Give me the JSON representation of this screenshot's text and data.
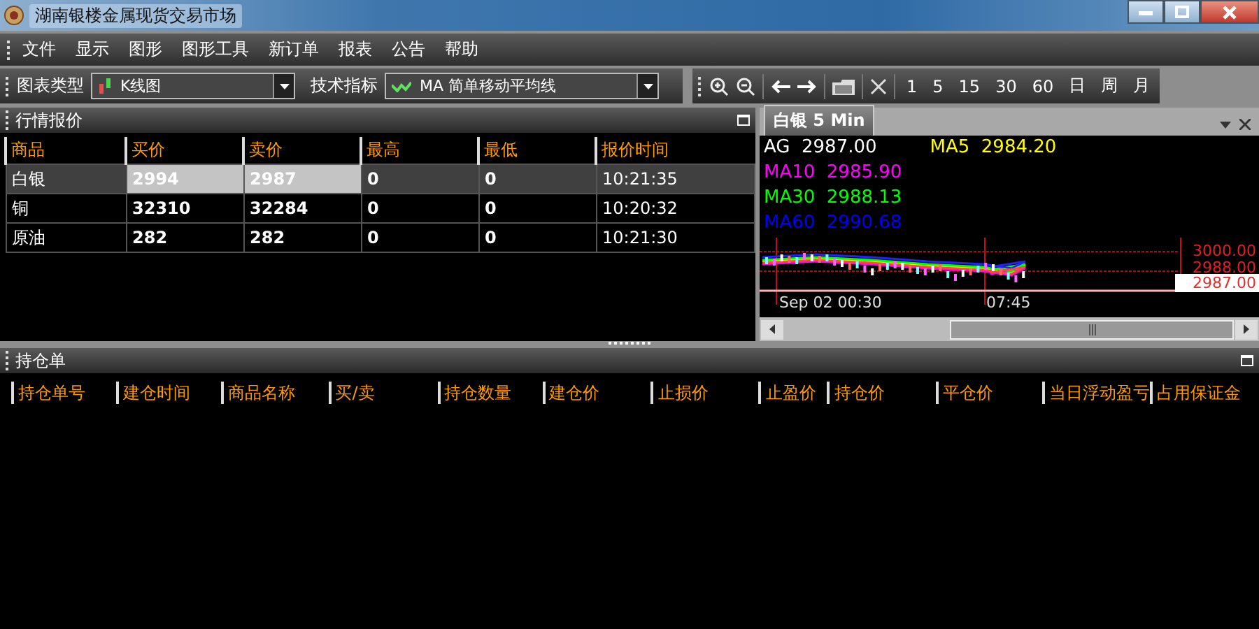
{
  "window": {
    "title": "湖南银楼金属现货交易市场"
  },
  "menu": [
    "文件",
    "显示",
    "图形",
    "图形工具",
    "新订单",
    "报表",
    "公告",
    "帮助"
  ],
  "toolbar": {
    "chart_type_label": "图表类型",
    "chart_type": "K线图",
    "indicator_label": "技术指标",
    "indicator": "MA 简单移动平均线",
    "periods": [
      "1",
      "5",
      "15",
      "30",
      "60",
      "日",
      "周",
      "月"
    ]
  },
  "quotes": {
    "title": "行情报价",
    "columns": [
      "商品",
      "买价",
      "卖价",
      "最高",
      "最低",
      "报价时间"
    ],
    "rows": [
      {
        "cells": [
          "白银",
          "2994",
          "2987",
          "0",
          "0",
          "10:21:35"
        ],
        "selected": true,
        "flash": true
      },
      {
        "cells": [
          "铜",
          "32310",
          "32284",
          "0",
          "0",
          "10:20:32"
        ],
        "selected": false,
        "flash": false
      },
      {
        "cells": [
          "原油",
          "282",
          "282",
          "0",
          "0",
          "10:21:30"
        ],
        "selected": false,
        "flash": false
      }
    ]
  },
  "chart": {
    "tab": "白银 5 Min",
    "lines": [
      {
        "label": "AG",
        "value": "2987.00",
        "color": "#ffffff"
      },
      {
        "label": "MA5",
        "value": "2984.20",
        "color": "#ffff00"
      },
      {
        "label": "MA10",
        "value": "2985.90",
        "color": "#ff00ff"
      },
      {
        "label": "MA30",
        "value": "2988.13",
        "color": "#00ff00"
      },
      {
        "label": "MA60",
        "value": "2990.68",
        "color": "#0000ff"
      }
    ],
    "price_labels": [
      "3000.00",
      "2988.00"
    ],
    "last_price": "2987.00",
    "time_labels": [
      "Sep 02 00:30",
      "07:45"
    ]
  },
  "positions": {
    "title": "持仓单",
    "columns": [
      "持仓单号",
      "建仓时间",
      "商品名称",
      "买/卖",
      "持仓数量",
      "建仓价",
      "止损价",
      "止盈价",
      "持仓价",
      "平仓价",
      "当日浮动盈亏",
      "占用保证金"
    ]
  }
}
